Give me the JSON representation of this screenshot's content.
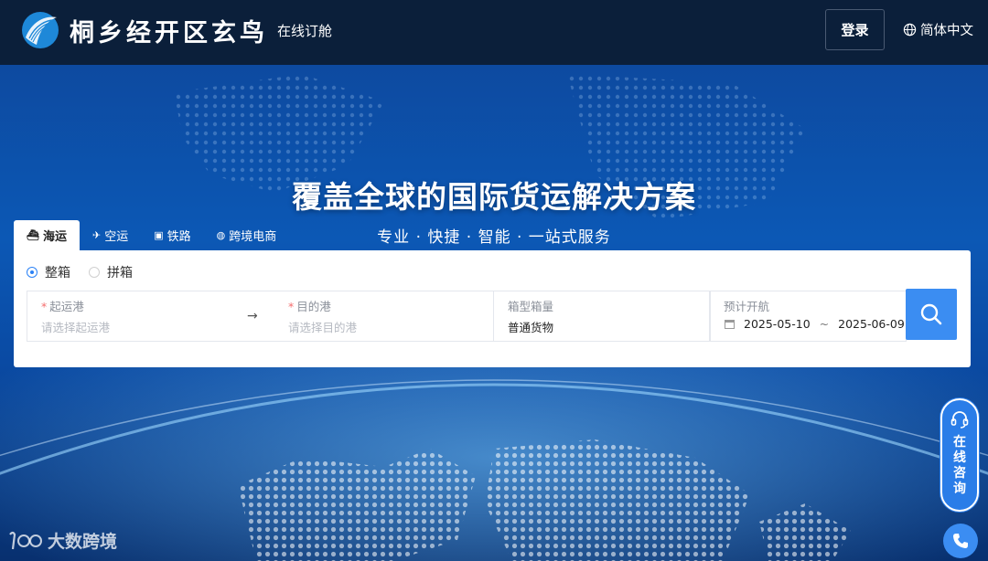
{
  "header": {
    "brand_name": "桐乡经开区玄鸟",
    "brand_sub": "在线订舱",
    "login_label": "登录",
    "language_label": "简体中文",
    "icons": {
      "logo": "bird-logo-icon",
      "language": "globe-icon"
    }
  },
  "hero": {
    "title": "覆盖全球的国际货运解决方案",
    "subtitle": "专业 · 快捷 · 智能 · 一站式服务"
  },
  "tabs": [
    {
      "label": "海运",
      "icon": "ship-icon",
      "active": true
    },
    {
      "label": "空运",
      "icon": "plane-icon",
      "active": false
    },
    {
      "label": "铁路",
      "icon": "train-icon",
      "active": false
    },
    {
      "label": "跨境电商",
      "icon": "globe-coin-icon",
      "active": false
    }
  ],
  "search": {
    "mode_options": [
      {
        "label": "整箱",
        "selected": true
      },
      {
        "label": "拼箱",
        "selected": false
      }
    ],
    "origin": {
      "label": "起运港",
      "required_mark": "*",
      "placeholder": "请选择起运港"
    },
    "destination": {
      "label": "目的港",
      "required_mark": "*",
      "placeholder": "请选择目的港"
    },
    "arrow": "→",
    "cargo": {
      "label": "箱型箱量",
      "value": "普通货物"
    },
    "sailing": {
      "label": "预计开航",
      "start": "2025-05-10",
      "separator": "~",
      "end": "2025-06-09"
    }
  },
  "consult": {
    "label": "在线咨询",
    "icon": "headset-icon",
    "phone_icon": "phone-icon"
  },
  "watermark": {
    "text": "大数跨境"
  },
  "colors": {
    "header_bg": "#0b1f3a",
    "accent": "#3b8df2",
    "hero_bg": "#0c58b5"
  }
}
